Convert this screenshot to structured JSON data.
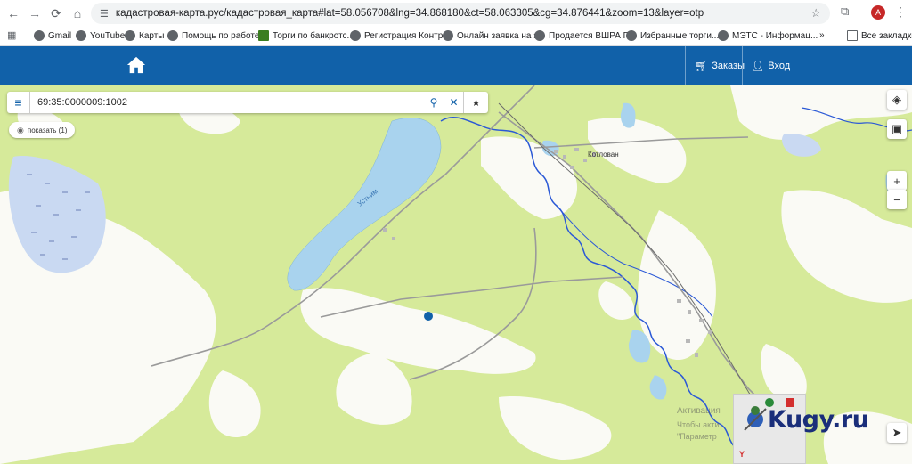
{
  "browser": {
    "url": "кадастровая-карта.рус/кадастровая_карта#lat=58.056708&lng=34.868180&ct=58.063305&cg=34.876441&zoom=13&layer=otp",
    "profile_initial": "A",
    "bookmarks": [
      {
        "label": "Gmail"
      },
      {
        "label": "YouTube"
      },
      {
        "label": "Карты"
      },
      {
        "label": "Помощь по работе..."
      },
      {
        "label": "Торги по банкротс..."
      },
      {
        "label": "Регистрация Контр..."
      },
      {
        "label": "Онлайн заявка на з..."
      },
      {
        "label": "Продается ВШРА П..."
      },
      {
        "label": "Избранные торги..."
      },
      {
        "label": "МЭТС - Информац..."
      }
    ],
    "more_bookmarks": "»",
    "all_bookmarks": "Все закладки"
  },
  "header": {
    "orders_label": "Заказы",
    "login_label": "Вход"
  },
  "search": {
    "value": "69:35:0000009:1002"
  },
  "show_button": "показать (1)",
  "map": {
    "place_kotlovan": "Котлован",
    "place_lake": "Устьим",
    "activation_line1": "Активация",
    "activation_line2": "Чтобы акти",
    "activation_line3": "\"Параметр"
  },
  "zoom": {
    "plus": "+",
    "minus": "−"
  },
  "watermark": "Kugy.ru",
  "colors": {
    "brand": "#1161a9",
    "forest": "#d6ea9a",
    "clearing": "#ffffff",
    "water": "#a9d3ee",
    "river": "#2b59d6"
  }
}
